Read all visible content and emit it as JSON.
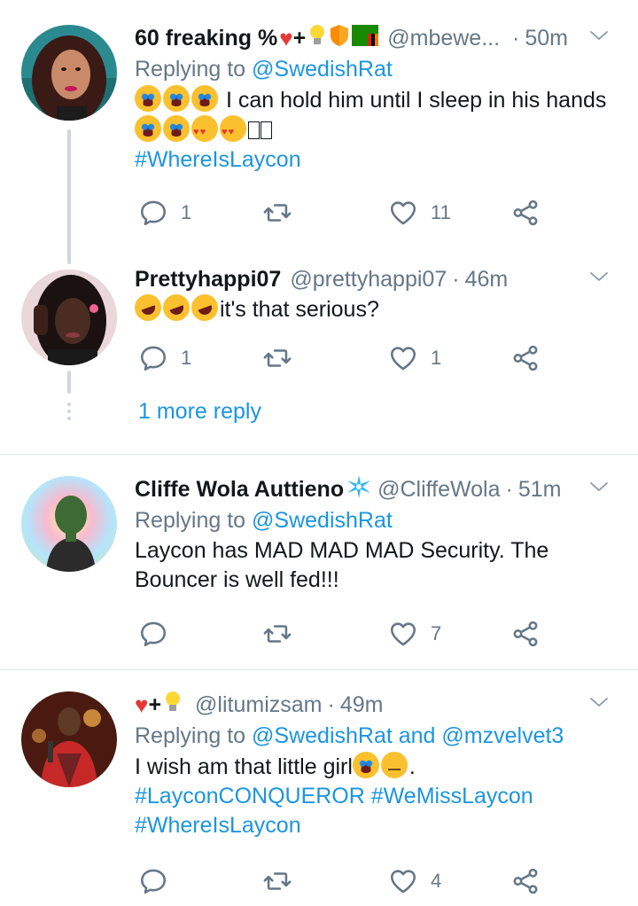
{
  "tweets": [
    {
      "name": "60 freaking %",
      "name_suffix": "+",
      "handle": "@mbewe...",
      "dot": "·",
      "time": "50m",
      "replying_prefix": "Replying to",
      "replying_to": "@SwedishRat",
      "text": "I can hold him until I sleep in his hands",
      "hashtags": [
        "#WhereIsLaycon"
      ],
      "replies": "1",
      "retweets": "",
      "likes": "11"
    },
    {
      "name": "Prettyhappi07",
      "handle": "@prettyhappi07",
      "dot": "·",
      "time": "46m",
      "text": "it's that serious?",
      "replies": "1",
      "retweets": "",
      "likes": "1"
    },
    {
      "name": "Cliffe Wola Auttieno",
      "handle": "@CliffeWola",
      "dot": "·",
      "time": "51m",
      "replying_prefix": "Replying to",
      "replying_to": "@SwedishRat",
      "text": "Laycon has MAD MAD MAD Security. The Bouncer is well fed!!!",
      "replies": "",
      "retweets": "",
      "likes": "7"
    },
    {
      "name": "+",
      "handle": "@litumizsam",
      "dot": "·",
      "time": "49m",
      "replying_prefix": "Replying to",
      "replying_to": "@SwedishRat and @mzvelvet3",
      "text": "I wish am that little girl",
      "text_end": ".",
      "hashtags": [
        "#LayconCONQUEROR #WeMissLaycon",
        "#WhereIsLaycon"
      ],
      "replies": "",
      "retweets": "",
      "likes": "4"
    }
  ],
  "more_reply": "1 more reply",
  "icons": {
    "reply": "reply-icon",
    "retweet": "retweet-icon",
    "like": "heart-icon",
    "share": "share-icon",
    "caret": "chevron-down-icon"
  },
  "colors": {
    "link": "#1b95e0",
    "muted": "#657786",
    "divider": "#e1e8ed",
    "thread": "#ccd6dd"
  }
}
